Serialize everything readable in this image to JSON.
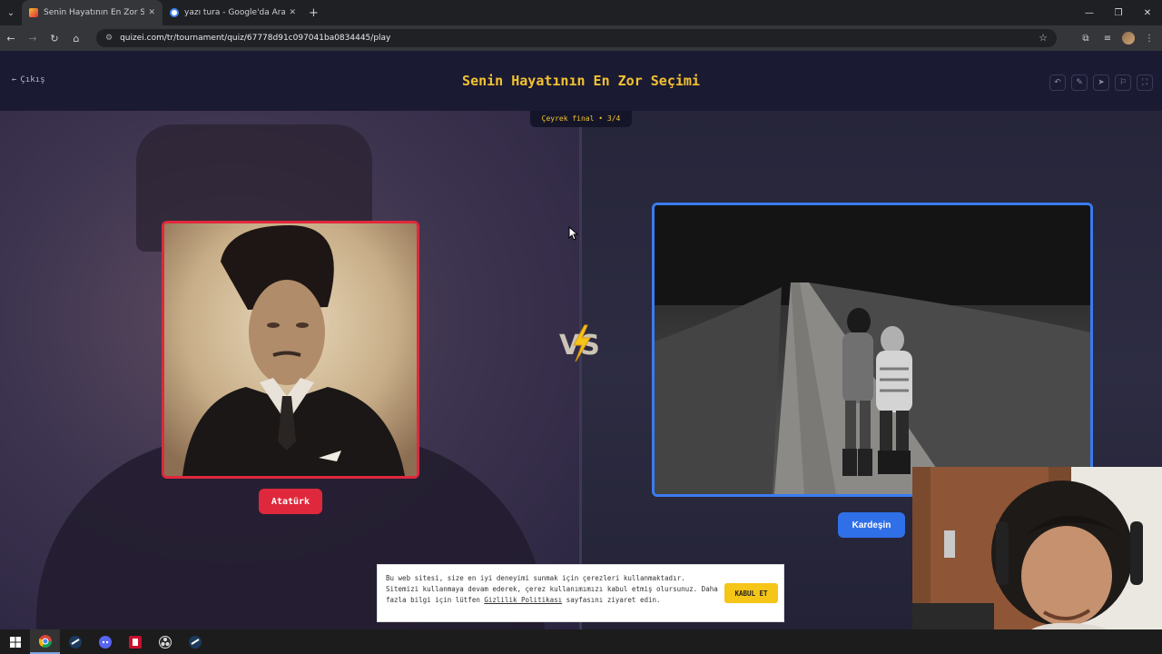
{
  "browser": {
    "tabs": [
      {
        "title": "Senin Hayatının En Zor Seçimi",
        "active": true,
        "favicon": "quizei-icon"
      },
      {
        "title": "yazı tura - Google'da Ara",
        "active": false,
        "favicon": "google-icon"
      }
    ],
    "url": "quizei.com/tr/tournament/quiz/67778d91c097041ba0834445/play"
  },
  "header": {
    "exit_label": "Çıkış",
    "title": "Senin Hayatının En Zor Seçimi",
    "tools": [
      "undo-icon",
      "edit-icon",
      "share-icon",
      "flag-icon",
      "fullscreen-icon"
    ]
  },
  "round": {
    "label": "Çeyrek final • 3/4"
  },
  "choices": {
    "left": {
      "label": "Atatürk",
      "color": "#e0283c"
    },
    "right": {
      "label": "Kardeşin",
      "color": "#2f6fe8"
    }
  },
  "vs_label": "VS",
  "cookie": {
    "text_before": "Bu web sitesi, size en iyi deneyimi sunmak için çerezleri kullanmaktadır. Sitemizi kullanmaya devam ederek, çerez kullanımımızı kabul etmiş olursunuz. Daha fazla bilgi için lütfen ",
    "link": "Gizlilik Politikası",
    "text_after": " sayfasını ziyaret edin.",
    "accept_label": "KABUL ET"
  },
  "taskbar": {
    "icons": [
      "windows-start-icon",
      "chrome-icon",
      "steam-icon",
      "discord-icon",
      "app-red-icon",
      "obs-icon",
      "steam-icon-2"
    ]
  },
  "colors": {
    "accent_title": "#f2c230",
    "left_border": "#e0283c",
    "right_border": "#3a7bf0"
  }
}
